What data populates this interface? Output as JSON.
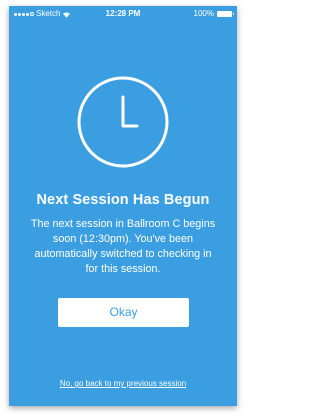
{
  "status_bar": {
    "carrier": "Sketch",
    "time": "12:28 PM",
    "battery": "100%"
  },
  "icon": "clock-icon",
  "modal": {
    "title": "Next Session Has Begun",
    "message": "The next session in Ballroom C begins soon (12:30pm). You've been automatically switched to checking in for this session.",
    "button_label": "Okay",
    "back_link": "No, go back to my previous session"
  },
  "colors": {
    "background": "#3a9ee0",
    "text": "#ffffff",
    "button_bg": "#ffffff",
    "button_text": "#3a9ee0"
  }
}
